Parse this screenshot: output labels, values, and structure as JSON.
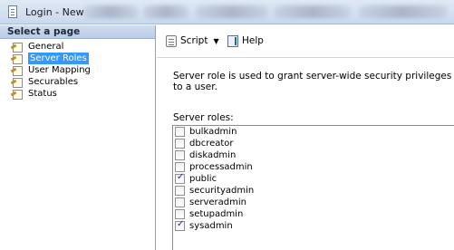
{
  "window": {
    "title": "Login - New"
  },
  "left_pane": {
    "header": "Select a page",
    "items": [
      {
        "label": "General",
        "selected": false
      },
      {
        "label": "Server Roles",
        "selected": true
      },
      {
        "label": "User Mapping",
        "selected": false
      },
      {
        "label": "Securables",
        "selected": false
      },
      {
        "label": "Status",
        "selected": false
      }
    ]
  },
  "toolbar": {
    "script_label": "Script",
    "help_label": "Help"
  },
  "content": {
    "description": "Server role is used to grant server-wide security privileges to a user.",
    "roles_label": "Server roles:",
    "roles": [
      {
        "name": "bulkadmin",
        "checked": false
      },
      {
        "name": "dbcreator",
        "checked": false
      },
      {
        "name": "diskadmin",
        "checked": false
      },
      {
        "name": "processadmin",
        "checked": false
      },
      {
        "name": "public",
        "checked": true
      },
      {
        "name": "securityadmin",
        "checked": false
      },
      {
        "name": "serveradmin",
        "checked": false
      },
      {
        "name": "setupadmin",
        "checked": false
      },
      {
        "name": "sysadmin",
        "checked": true
      }
    ]
  }
}
